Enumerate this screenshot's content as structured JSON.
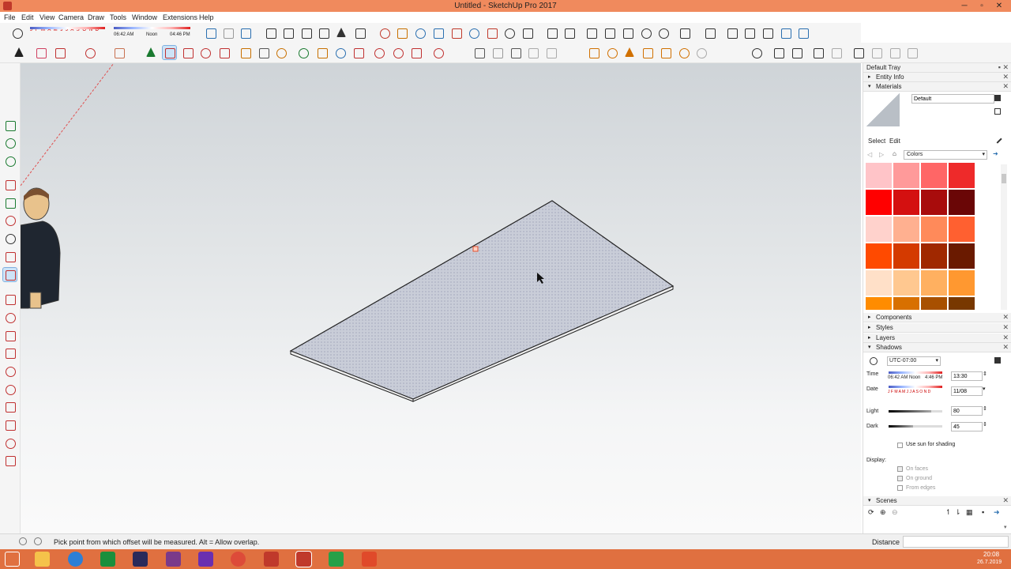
{
  "window": {
    "title": "Untitled - SketchUp Pro 2017",
    "minimize": "─",
    "maximize": "▫",
    "close": "✕"
  },
  "menu": [
    "File",
    "Edit",
    "View",
    "Camera",
    "Draw",
    "Tools",
    "Window",
    "Extensions",
    "Help"
  ],
  "shadow_toolbar": {
    "months": "J F M A M J J A S O N D",
    "time_start": "06:42 AM",
    "time_noon": "Noon",
    "time_end": "04:46 PM"
  },
  "tray": {
    "title": "Default Tray",
    "panels": {
      "entity_info": "Entity Info",
      "materials": "Materials",
      "components": "Components",
      "styles": "Styles",
      "layers": "Layers",
      "shadows": "Shadows",
      "scenes": "Scenes"
    },
    "materials": {
      "name_value": "Default",
      "tab_select": "Select",
      "tab_edit": "Edit",
      "library": "Colors",
      "swatches": [
        "#ffc4c8",
        "#ff9a9a",
        "#ff6666",
        "#ee2a2a",
        "#ff0000",
        "#d41010",
        "#a80c0c",
        "#6a0606",
        "#ffd2cc",
        "#ffb090",
        "#ff8a5a",
        "#ff6030",
        "#ff4a00",
        "#d43a00",
        "#a02800",
        "#6a1a00",
        "#ffe0c8",
        "#ffc890",
        "#ffb060",
        "#ff9830"
      ],
      "swatches_partial": [
        "#ff8c00",
        "#d87000",
        "#a85000",
        "#783800"
      ]
    },
    "shadows": {
      "timezone": "UTC-07:00",
      "time_label": "Time",
      "time_start": "06:42 AM",
      "time_noon": "Noon",
      "time_end": "4:46 PM",
      "time_value": "13:30",
      "date_label": "Date",
      "months": "J F M A M J J A S O N D",
      "date_value": "11/08",
      "light_label": "Light",
      "light_value": "80",
      "light_level": 0.8,
      "dark_label": "Dark",
      "dark_value": "45",
      "dark_level": 0.45,
      "use_sun": "Use sun for shading",
      "display_label": "Display:",
      "on_faces": "On faces",
      "on_ground": "On ground",
      "from_edges": "From edges"
    },
    "measure_label": "Distance"
  },
  "status": {
    "message": "Pick point from which offset will be measured. Alt = Allow overlap."
  },
  "clock": {
    "time": "20:08",
    "date": "26.7.2019"
  },
  "colors": {
    "titlebar": "#f08a5d",
    "taskbar": "#e07040",
    "accent": "#ee2a2a"
  }
}
